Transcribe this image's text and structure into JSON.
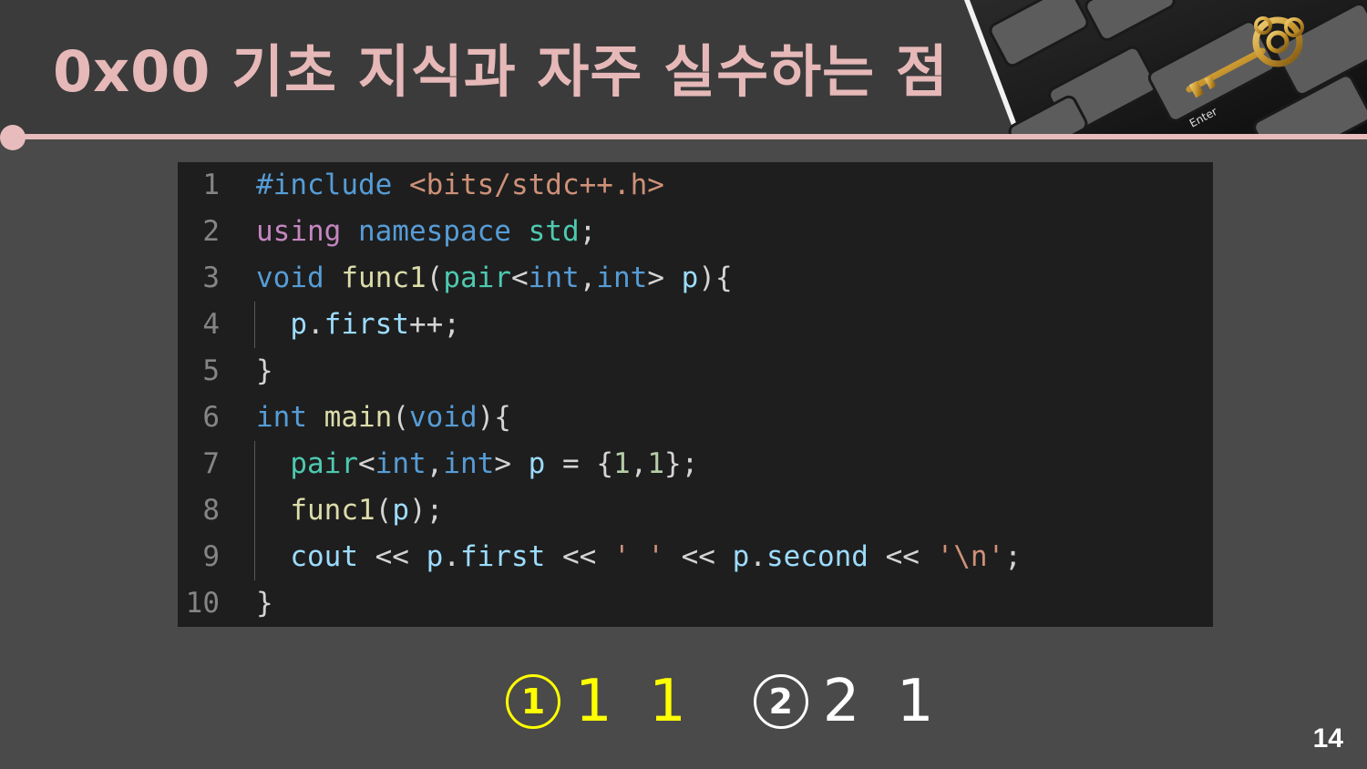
{
  "slide": {
    "title": "0x00  기초 지식과 자주 실수하는 점",
    "page_number": "14",
    "photo_text": "Enter"
  },
  "code": {
    "lines": [
      {
        "num": "1",
        "tokens": [
          {
            "t": "#include ",
            "c": "#569cd6"
          },
          {
            "t": "<bits/stdc++.h>",
            "c": "#ce9178"
          }
        ]
      },
      {
        "num": "2",
        "tokens": [
          {
            "t": "using ",
            "c": "#c586c0"
          },
          {
            "t": "namespace ",
            "c": "#569cd6"
          },
          {
            "t": "std",
            "c": "#4ec9b0"
          },
          {
            "t": ";",
            "c": "#d4d4d4"
          }
        ]
      },
      {
        "num": "3",
        "tokens": [
          {
            "t": "void ",
            "c": "#569cd6"
          },
          {
            "t": "func1",
            "c": "#dcdcaa"
          },
          {
            "t": "(",
            "c": "#d4d4d4"
          },
          {
            "t": "pair",
            "c": "#4ec9b0"
          },
          {
            "t": "<",
            "c": "#d4d4d4"
          },
          {
            "t": "int",
            "c": "#569cd6"
          },
          {
            "t": ",",
            "c": "#d4d4d4"
          },
          {
            "t": "int",
            "c": "#569cd6"
          },
          {
            "t": "> ",
            "c": "#d4d4d4"
          },
          {
            "t": "p",
            "c": "#9cdcfe"
          },
          {
            "t": "){",
            "c": "#d4d4d4"
          }
        ]
      },
      {
        "num": "4",
        "tokens": [
          {
            "t": "  ",
            "c": "#d4d4d4"
          },
          {
            "t": "p",
            "c": "#9cdcfe"
          },
          {
            "t": ".",
            "c": "#d4d4d4"
          },
          {
            "t": "first",
            "c": "#9cdcfe"
          },
          {
            "t": "++;",
            "c": "#d4d4d4"
          }
        ]
      },
      {
        "num": "5",
        "tokens": [
          {
            "t": "}",
            "c": "#d4d4d4"
          }
        ]
      },
      {
        "num": "6",
        "tokens": [
          {
            "t": "int ",
            "c": "#569cd6"
          },
          {
            "t": "main",
            "c": "#dcdcaa"
          },
          {
            "t": "(",
            "c": "#d4d4d4"
          },
          {
            "t": "void",
            "c": "#569cd6"
          },
          {
            "t": "){",
            "c": "#d4d4d4"
          }
        ]
      },
      {
        "num": "7",
        "tokens": [
          {
            "t": "  ",
            "c": "#d4d4d4"
          },
          {
            "t": "pair",
            "c": "#4ec9b0"
          },
          {
            "t": "<",
            "c": "#d4d4d4"
          },
          {
            "t": "int",
            "c": "#569cd6"
          },
          {
            "t": ",",
            "c": "#d4d4d4"
          },
          {
            "t": "int",
            "c": "#569cd6"
          },
          {
            "t": "> ",
            "c": "#d4d4d4"
          },
          {
            "t": "p",
            "c": "#9cdcfe"
          },
          {
            "t": " = {",
            "c": "#d4d4d4"
          },
          {
            "t": "1",
            "c": "#b5cea8"
          },
          {
            "t": ",",
            "c": "#d4d4d4"
          },
          {
            "t": "1",
            "c": "#b5cea8"
          },
          {
            "t": "};",
            "c": "#d4d4d4"
          }
        ]
      },
      {
        "num": "8",
        "tokens": [
          {
            "t": "  ",
            "c": "#d4d4d4"
          },
          {
            "t": "func1",
            "c": "#dcdcaa"
          },
          {
            "t": "(",
            "c": "#d4d4d4"
          },
          {
            "t": "p",
            "c": "#9cdcfe"
          },
          {
            "t": ");",
            "c": "#d4d4d4"
          }
        ]
      },
      {
        "num": "9",
        "tokens": [
          {
            "t": "  ",
            "c": "#d4d4d4"
          },
          {
            "t": "cout",
            "c": "#9cdcfe"
          },
          {
            "t": " << ",
            "c": "#d4d4d4"
          },
          {
            "t": "p",
            "c": "#9cdcfe"
          },
          {
            "t": ".",
            "c": "#d4d4d4"
          },
          {
            "t": "first",
            "c": "#9cdcfe"
          },
          {
            "t": " << ",
            "c": "#d4d4d4"
          },
          {
            "t": "' '",
            "c": "#ce9178"
          },
          {
            "t": " << ",
            "c": "#d4d4d4"
          },
          {
            "t": "p",
            "c": "#9cdcfe"
          },
          {
            "t": ".",
            "c": "#d4d4d4"
          },
          {
            "t": "second",
            "c": "#9cdcfe"
          },
          {
            "t": " << ",
            "c": "#d4d4d4"
          },
          {
            "t": "'\\n'",
            "c": "#ce9178"
          },
          {
            "t": ";",
            "c": "#d4d4d4"
          }
        ]
      },
      {
        "num": "10",
        "tokens": [
          {
            "t": "}",
            "c": "#d4d4d4"
          }
        ]
      }
    ]
  },
  "options": [
    {
      "marker": "1",
      "text": "1 1",
      "color": "#ffff00"
    },
    {
      "marker": "2",
      "text": "2 1",
      "color": "#ffffff"
    }
  ],
  "colors": {
    "title": "#e6b8b8",
    "accent": "#e8bcbc",
    "background": "#4a4a4a",
    "header_background": "#3b3b3b",
    "code_background": "#1e1e1e"
  }
}
